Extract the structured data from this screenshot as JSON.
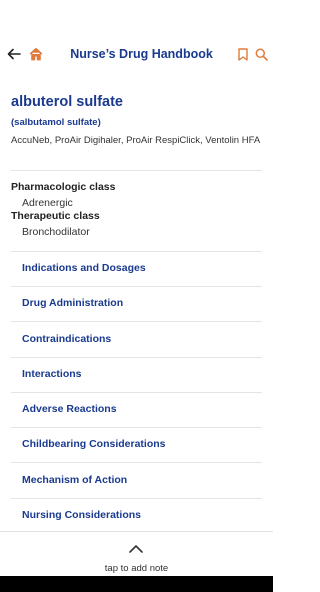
{
  "header": {
    "title": "Nurse’s Drug Handbook",
    "icons": [
      "back-arrow-icon",
      "home-icon",
      "bookmark-icon",
      "search-icon"
    ]
  },
  "drug": {
    "name": "albuterol sulfate",
    "generic": "(salbutamol sulfate)",
    "brands": "AccuNeb, ProAir Digihaler, ProAir RespiClick, Ventolin HFA",
    "pharmacologic_label": "Pharmacologic class",
    "pharmacologic_value": "Adrenergic",
    "therapeutic_label": "Therapeutic class",
    "therapeutic_value": "Bronchodilator"
  },
  "sections": [
    "Indications and Dosages",
    "Drug Administration",
    "Contraindications",
    "Interactions",
    "Adverse Reactions",
    "Childbearing Considerations",
    "Mechanism of Action",
    "Nursing Considerations"
  ],
  "note": {
    "label": "tap to add note"
  },
  "colors": {
    "accent": "#1a3a8f",
    "icon_orange": "#e07b3c"
  }
}
